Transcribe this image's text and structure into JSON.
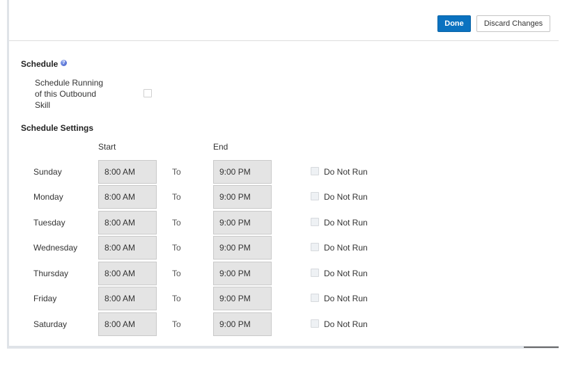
{
  "toolbar": {
    "done_label": "Done",
    "discard_label": "Discard Changes"
  },
  "schedule": {
    "title": "Schedule",
    "help_icon": "question-circle-icon",
    "run_label": "Schedule Running of this Outbound Skill",
    "run_checked": false
  },
  "settings": {
    "title": "Schedule Settings",
    "start_header": "Start",
    "end_header": "End",
    "to_label": "To",
    "do_not_run_label": "Do Not Run",
    "days": [
      {
        "day": "Sunday",
        "start": "8:00 AM",
        "end": "9:00 PM",
        "do_not_run": false
      },
      {
        "day": "Monday",
        "start": "8:00 AM",
        "end": "9:00 PM",
        "do_not_run": false
      },
      {
        "day": "Tuesday",
        "start": "8:00 AM",
        "end": "9:00 PM",
        "do_not_run": false
      },
      {
        "day": "Wednesday",
        "start": "8:00 AM",
        "end": "9:00 PM",
        "do_not_run": false
      },
      {
        "day": "Thursday",
        "start": "8:00 AM",
        "end": "9:00 PM",
        "do_not_run": false
      },
      {
        "day": "Friday",
        "start": "8:00 AM",
        "end": "9:00 PM",
        "do_not_run": false
      },
      {
        "day": "Saturday",
        "start": "8:00 AM",
        "end": "9:00 PM",
        "do_not_run": false
      }
    ]
  },
  "colors": {
    "primary": "#0a72c0",
    "field_bg": "#e4e4e4",
    "border": "#dfe3e8"
  }
}
